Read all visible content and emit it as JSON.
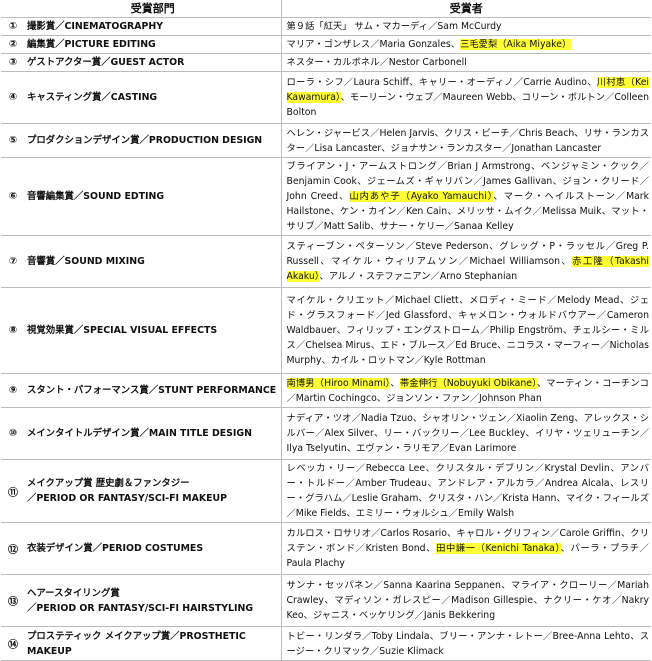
{
  "header": {
    "category": "受賞部門",
    "winner": "受賞者"
  },
  "rows": [
    {
      "num": "①",
      "category": "撮影賞／CINEMATOGRAPHY",
      "winner": [
        {
          "t": "第９話「紅天」 サム・マカーディ／Sam McCurdy"
        }
      ]
    },
    {
      "num": "②",
      "category": "編集賞／PICTURE EDITING",
      "winner": [
        {
          "t": "マリア・ゴンザレス／Maria Gonzales、"
        },
        {
          "t": "三毛愛梨（Aika Miyake）",
          "hl": true
        }
      ]
    },
    {
      "num": "③",
      "category": "ゲストアクター賞／GUEST ACTOR",
      "winner": [
        {
          "t": "ネスター・カルボネル／Nestor Carbonell"
        }
      ]
    },
    {
      "num": "④",
      "category": "キャスティング賞／CASTING",
      "winner": [
        {
          "t": "ローラ・シフ／Laura Schiff、キャリー・オーディノ／Carrie Audino、"
        },
        {
          "t": "川村恵（Kei Kawamura）",
          "hl": true
        },
        {
          "t": "、モーリーン・ウェブ／Maureen Webb、コリーン・ボルトン／Colleen Bolton"
        }
      ]
    },
    {
      "num": "⑤",
      "category": "プロダクションデザイン賞／PRODUCTION DESIGN",
      "winner": [
        {
          "t": "ヘレン・ジャービス／Helen Jarvis、クリス・ビーチ／Chris Beach、リサ・ランカスター／Lisa Lancaster、ジョナサン・ランカスター／Jonathan Lancaster"
        }
      ]
    },
    {
      "num": "⑥",
      "category": "音響編集賞／SOUND EDTING",
      "winner": [
        {
          "t": "ブライアン・J・アームストロング／Brian J Armstrong、ベンジャミン・クック／Benjamin Cook、ジェームズ・ギャリバン／James Gallivan、ジョン・クリード／John Creed、"
        },
        {
          "t": "山内あや子（Ayako Yamauchi）",
          "hl": true
        },
        {
          "t": "、マーク・ヘイルストーン／Mark Hailstone、ケン・カイン／Ken Cain、メリッサ・ムイク／Melissa Muik、マット・サリブ／Matt Salib、サナー・ケリー／Sanaa Kelley"
        }
      ]
    },
    {
      "num": "⑦",
      "category": "音響賞／SOUND MIXING",
      "winner": [
        {
          "t": "スティーブン・ペターソン／Steve Pederson、グレッグ・P・ラッセル／Greg P. Russell、マイケル・ウィリアムソン／Michael Williamson、"
        },
        {
          "t": "赤工隆（Takashi Akaku）",
          "hl": true
        },
        {
          "t": "、アルノ・ステファニアン／Arno Stephanian"
        }
      ]
    },
    {
      "num": "⑧",
      "category": "視覚効果賞／SPECIAL VISUAL EFFECTS",
      "winner": [
        {
          "t": "マイケル・クリエット／Michael Cliett、メロディ・ミード／Melody Mead、ジェド・グラスフォード／Jed Glassford、キャメロン・ウォルドバウアー／Cameron Waldbauer、フィリップ・エングストローム／Philip Engström、チェルシー・ミルス／Chelsea Mirus、エド・ブルース／Ed Bruce、ニコラス・マーフィー／Nicholas Murphy、カイル・ロットマン／Kyle Rottman"
        }
      ]
    },
    {
      "num": "⑨",
      "category": "スタント・パフォーマンス賞／STUNT PERFORMANCE",
      "winner": [
        {
          "t": "南博男（Hiroo Minami）",
          "hl": true
        },
        {
          "t": "、"
        },
        {
          "t": "帯金伸行（Nobuyuki Obikane）",
          "hl": true
        },
        {
          "t": "、マーティン・コーチンコ／Martin Cochingco、ジョンソン・ファン／Johnson Phan"
        }
      ]
    },
    {
      "num": "⑩",
      "category": "メインタイトルデザイン賞／MAIN TITLE DESIGN",
      "winner": [
        {
          "t": "ナディア・ツオ／Nadia Tzuo、シャオリン・ツェン／Xiaolin Zeng、アレックス・シルバー／Alex Silver、リー・バックリー／Lee Buckley、イリヤ・ツェリューチン／Ilya Tselyutin、エヴァン・ラリモア／Evan Larimore"
        }
      ]
    },
    {
      "num": "⑪",
      "category": "メイクアップ賞 歴史劇＆ファンタジー／PERIOD OR FANTASY/SCI-FI MAKEUP",
      "winner": [
        {
          "t": "レベッカ・リー／Rebecca Lee、クリスタル・デブリン／Krystal Devlin、アンバー・トルドー／Amber Trudeau、アンドレア・アルカラ／Andrea Alcala、レスリー・グラハム／Leslie Graham、クリスタ・ハン／Krista Hann、マイク・フィールズ／Mike Fields、エミリー・ウォルシュ／Emily Walsh"
        }
      ]
    },
    {
      "num": "⑫",
      "category": "衣装デザイン賞／PERIOD COSTUMES",
      "winner": [
        {
          "t": "カルロス・ロサリオ／Carlos Rosario、キャロル・グリフィン／Carole Griffin、クリステン・ボンド／Kristen Bond、"
        },
        {
          "t": "田中謙一（Kenichi Tanaka）",
          "hl": true
        },
        {
          "t": "、パーラ・プラチ／Paula Plachy"
        }
      ]
    },
    {
      "num": "⑬",
      "category": "ヘアースタイリング賞／PERIOD OR FANTASY/SCI-FI HAIRSTYLING",
      "winner": [
        {
          "t": "サンナ・セッパネン／Sanna Kaarina Seppanen、マライア・クローリー／Mariah Crawley、マディソン・ガレスピー／Madison Gillespie、ナクリー・ケオ／Nakry Keo、ジャニス・ベッケリング／Janis Bekkering"
        }
      ]
    },
    {
      "num": "⑭",
      "category": "プロステティック メイクアップ賞／PROSTHETIC MAKEUP",
      "winner": [
        {
          "t": "トビー・リンダラ／Toby Lindala、ブリー・アンナ・レトー／Bree-Anna Lehto、スージー・クリマック／Suzie Klimack"
        }
      ]
    }
  ]
}
